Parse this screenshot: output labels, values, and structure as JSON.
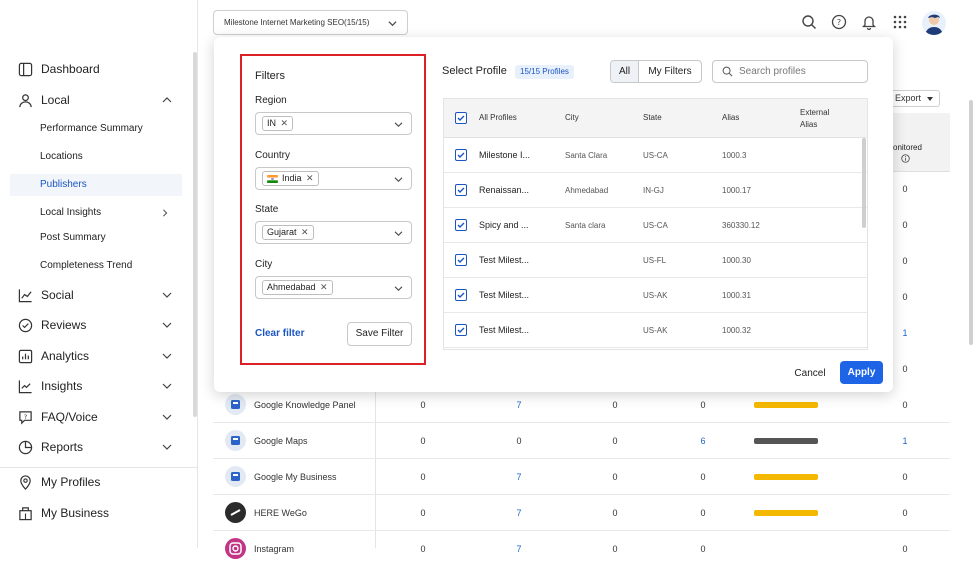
{
  "header": {
    "account_selector": "Milestone Internet Marketing SEO(15/15)"
  },
  "sidebar": {
    "items": [
      {
        "label": "Dashboard"
      },
      {
        "label": "Local"
      },
      {
        "label": "Social"
      },
      {
        "label": "Reviews"
      },
      {
        "label": "Analytics"
      },
      {
        "label": "Insights"
      },
      {
        "label": "FAQ/Voice"
      },
      {
        "label": "Reports"
      },
      {
        "label": "My Profiles"
      },
      {
        "label": "My Business"
      }
    ],
    "local_subitems": [
      {
        "label": "Performance Summary"
      },
      {
        "label": "Locations"
      },
      {
        "label": "Publishers",
        "active": true
      },
      {
        "label": "Local Insights"
      },
      {
        "label": "Post Summary"
      },
      {
        "label": "Completeness Trend"
      }
    ]
  },
  "background_table": {
    "export_label": "Export",
    "monitored_header": "onitored",
    "right_col_values": [
      "0",
      "0",
      "0",
      "0",
      "1",
      "0"
    ],
    "rows": [
      {
        "name": "Google Knowledge Panel",
        "icon": "google-knowledge-panel-icon",
        "c1": "0",
        "c2": "7",
        "c3": "0",
        "c4": "0",
        "bar": "#f5b800",
        "c5": "0"
      },
      {
        "name": "Google Maps",
        "icon": "google-maps-icon",
        "c1": "0",
        "c2": "0",
        "c3": "0",
        "c4": "6",
        "bar": "#555555",
        "c5": "1"
      },
      {
        "name": "Google My Business",
        "icon": "google-my-business-icon",
        "c1": "0",
        "c2": "7",
        "c3": "0",
        "c4": "0",
        "bar": "#f5b800",
        "c5": "0"
      },
      {
        "name": "HERE WeGo",
        "icon": "here-wego-icon",
        "c1": "0",
        "c2": "7",
        "c3": "0",
        "c4": "0",
        "bar": "#f5b800",
        "c5": "0"
      },
      {
        "name": "Instagram",
        "icon": "instagram-icon",
        "c1": "0",
        "c2": "7",
        "c3": "0",
        "c4": "0",
        "bar": "#f5b800",
        "c5": "0"
      }
    ]
  },
  "filters": {
    "title": "Filters",
    "region": {
      "label": "Region",
      "value": "IN"
    },
    "country": {
      "label": "Country",
      "value": "India"
    },
    "state": {
      "label": "State",
      "value": "Gujarat"
    },
    "city": {
      "label": "City",
      "value": "Ahmedabad"
    },
    "clear_label": "Clear filter",
    "save_label": "Save Filter"
  },
  "select_profile": {
    "title": "Select Profile",
    "count_badge": "15/15 Profiles",
    "tab_all": "All",
    "tab_my_filters": "My Filters",
    "search_placeholder": "Search profiles",
    "columns": {
      "all_profiles": "All Profiles",
      "city": "City",
      "state": "State",
      "alias": "Alias",
      "external_alias": "External Alias"
    },
    "rows": [
      {
        "name": "Milestone I...",
        "city": "Santa Clara",
        "state": "US-CA",
        "alias": "1000.3",
        "checked": true
      },
      {
        "name": "Renaissan...",
        "city": "Ahmedabad",
        "state": "IN-GJ",
        "alias": "1000.17",
        "checked": true
      },
      {
        "name": "Spicy and ...",
        "city": "Santa clara",
        "state": "US-CA",
        "alias": "360330.12",
        "checked": true
      },
      {
        "name": "Test Milest...",
        "city": "",
        "state": "US-FL",
        "alias": "1000.30",
        "checked": true
      },
      {
        "name": "Test Milest...",
        "city": "",
        "state": "US-AK",
        "alias": "1000.31",
        "checked": true
      },
      {
        "name": "Test Milest...",
        "city": "",
        "state": "US-AK",
        "alias": "1000.32",
        "checked": true
      }
    ],
    "cancel_label": "Cancel",
    "apply_label": "Apply"
  },
  "colors": {
    "accent": "#1d64e6",
    "highlight_border": "#dd1f26",
    "link": "#1a55c4"
  }
}
